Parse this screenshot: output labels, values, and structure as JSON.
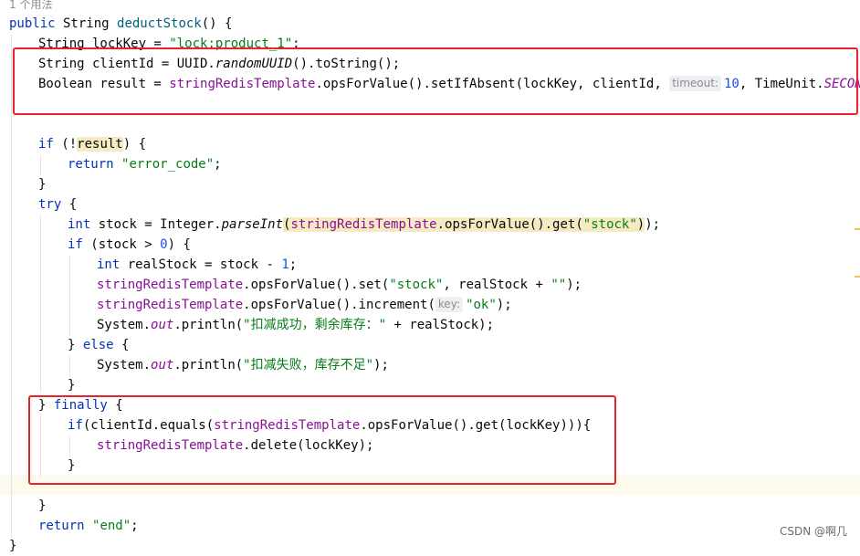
{
  "usage_hint": "1 个用法",
  "code": {
    "sig_public": "public",
    "sig_rest": " String ",
    "method_name": "deductStock",
    "sig_end": "() {",
    "l2_decl": "String lockKey = ",
    "l2_str": "\"lock:product_1\"",
    "l2_end": ";",
    "l3_a": "String clientId = UUID.",
    "l3_call": "randomUUID",
    "l3_b": "().toString();",
    "l4_a": "Boolean result = ",
    "l4_field": "stringRedisTemplate",
    "l4_b": ".opsForValue().setIfAbsent(lockKey, clientId, ",
    "l4_hint": "timeout:",
    "l4_num": "10",
    "l4_c": ", TimeUnit.",
    "l4_const": "SECONDS",
    "l4_end": ");",
    "l5_if": "if",
    "l5_a": " (!",
    "l5_var": "result",
    "l5_b": ") {",
    "l6_ret": "return",
    "l6_str": "\"error_code\"",
    "l6_end": ";",
    "l7": "}",
    "l8_try": "try",
    "l8_b": " {",
    "l9_int": "int",
    "l9_a": " stock = Integer.",
    "l9_call": "parseInt",
    "l9_p": "(",
    "l9_field": "stringRedisTemplate",
    "l9_b": ".opsForValue().get(",
    "l9_str": "\"stock\"",
    "l9_pc": ")",
    "l9_end": ");",
    "l10_if": "if",
    "l10_a": " (stock > ",
    "l10_num": "0",
    "l10_b": ") {",
    "l11_int": "int",
    "l11_a": " realStock = stock - ",
    "l11_num": "1",
    "l11_end": ";",
    "l12_field": "stringRedisTemplate",
    "l12_a": ".opsForValue().set(",
    "l12_str": "\"stock\"",
    "l12_b": ", realStock + ",
    "l12_str2": "\"\"",
    "l12_end": ");",
    "l13_field": "stringRedisTemplate",
    "l13_a": ".opsForValue().increment(",
    "l13_hint": "key:",
    "l13_str": "\"ok\"",
    "l13_end": ");",
    "l14_a": "System.",
    "l14_out": "out",
    "l14_b": ".println(",
    "l14_str": "\"扣减成功，剩余库存：\"",
    "l14_c": " + realStock);",
    "l15_a": "} ",
    "l15_else": "else",
    "l15_b": " {",
    "l16_a": "System.",
    "l16_out": "out",
    "l16_b": ".println(",
    "l16_str": "\"扣减失败，库存不足\"",
    "l16_end": ");",
    "l17": "}",
    "l18_a": "} ",
    "l18_finally": "finally",
    "l18_b": " {",
    "l19_if": "if",
    "l19_a": "(clientId.equals(",
    "l19_field": "stringRedisTemplate",
    "l19_b": ".opsForValue().get(lockKey))){",
    "l20_field": "stringRedisTemplate",
    "l20_a": ".delete(lockKey);",
    "l21": "}",
    "l23": "}",
    "l24_ret": "return",
    "l24_str": "\"end\"",
    "l24_end": ";",
    "l25": "}"
  },
  "watermark": "CSDN @啊几",
  "colors": {
    "keyword": "#0033b3",
    "string": "#067d17",
    "number": "#1750eb",
    "field": "#871094",
    "highlight_box": "#e8212c"
  }
}
